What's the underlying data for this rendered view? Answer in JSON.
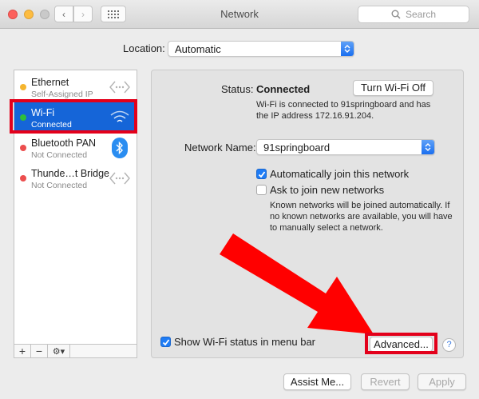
{
  "window": {
    "title": "Network"
  },
  "toolbar": {
    "search_placeholder": "Search"
  },
  "location": {
    "label": "Location:",
    "value": "Automatic"
  },
  "services": [
    {
      "name": "Ethernet",
      "status": "Self-Assigned IP",
      "dot_color": "#f5b52e",
      "icon": "ethernet-arrows-icon"
    },
    {
      "name": "Wi-Fi",
      "status": "Connected",
      "dot_color": "#2fbf3a",
      "icon": "wifi-icon"
    },
    {
      "name": "Bluetooth PAN",
      "status": "Not Connected",
      "dot_color": "#ec4e4e",
      "icon": "bluetooth-icon"
    },
    {
      "name": "Thunde…t Bridge",
      "status": "Not Connected",
      "dot_color": "#ec4e4e",
      "icon": "ethernet-arrows-icon"
    }
  ],
  "sidebar_footer": {
    "add": "+",
    "remove": "−",
    "action": "⚙▾"
  },
  "detail": {
    "status_label": "Status:",
    "status_value": "Connected",
    "turn_off_button": "Turn Wi-Fi Off",
    "status_desc_line1": "Wi-Fi is connected to 91springboard and has",
    "status_desc_line2": "the IP address 172.16.91.204.",
    "network_name_label": "Network Name:",
    "network_name_value": "91springboard",
    "auto_join_label": "Automatically join this network",
    "auto_join_checked": true,
    "ask_join_label": "Ask to join new networks",
    "ask_join_checked": false,
    "ask_join_desc_line1": "Known networks will be joined automatically. If",
    "ask_join_desc_line2": "no known networks are available, you will have",
    "ask_join_desc_line3": "to manually select a network.",
    "menu_bar_label": "Show Wi-Fi status in menu bar",
    "menu_bar_checked": true,
    "advanced_button": "Advanced...",
    "help_button": "?"
  },
  "footer": {
    "assist_button": "Assist Me...",
    "revert_button": "Revert",
    "apply_button": "Apply"
  },
  "colors": {
    "highlight": "#e3001b",
    "selection": "#1565d8",
    "accent": "#1f7cf5"
  }
}
